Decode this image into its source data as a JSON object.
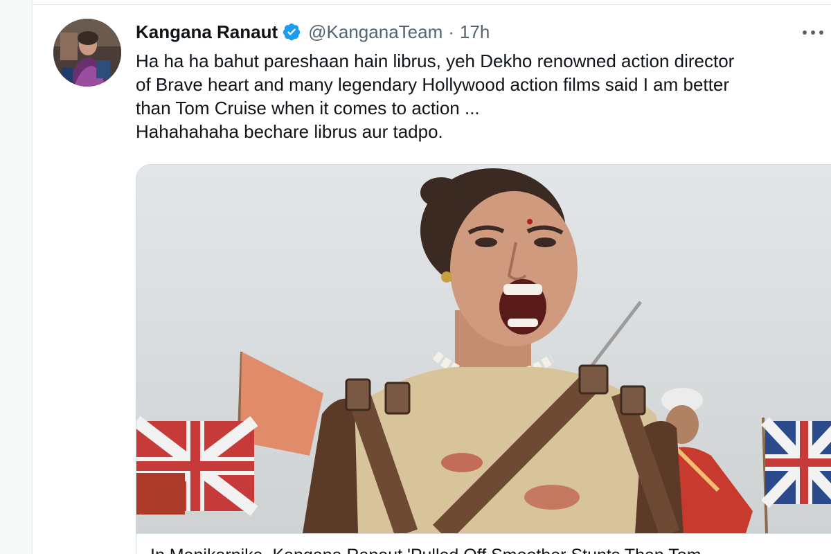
{
  "tweet": {
    "author_name": "Kangana Ranaut",
    "handle": "@KanganaTeam",
    "separator": "·",
    "time": "17h",
    "more_icon": "more-horizontal-icon",
    "verified_icon": "verified-badge-icon",
    "text_lines": [
      "Ha ha ha bahut pareshaan hain librus, yeh Dekho renowned action director",
      "of Brave heart and many legendary Hollywood action films said I am better",
      "than Tom Cruise when it comes to action ...",
      "Hahahahaha bechare librus aur tadpo."
    ],
    "card": {
      "title": "In Manikarnika, Kangana Ranaut 'Pulled Off Smoother Stunts Than Tom"
    }
  },
  "colors": {
    "verified": "#1d9bf0",
    "text": "#0f1419",
    "secondary_text": "#536471",
    "border": "#cfd9de"
  }
}
